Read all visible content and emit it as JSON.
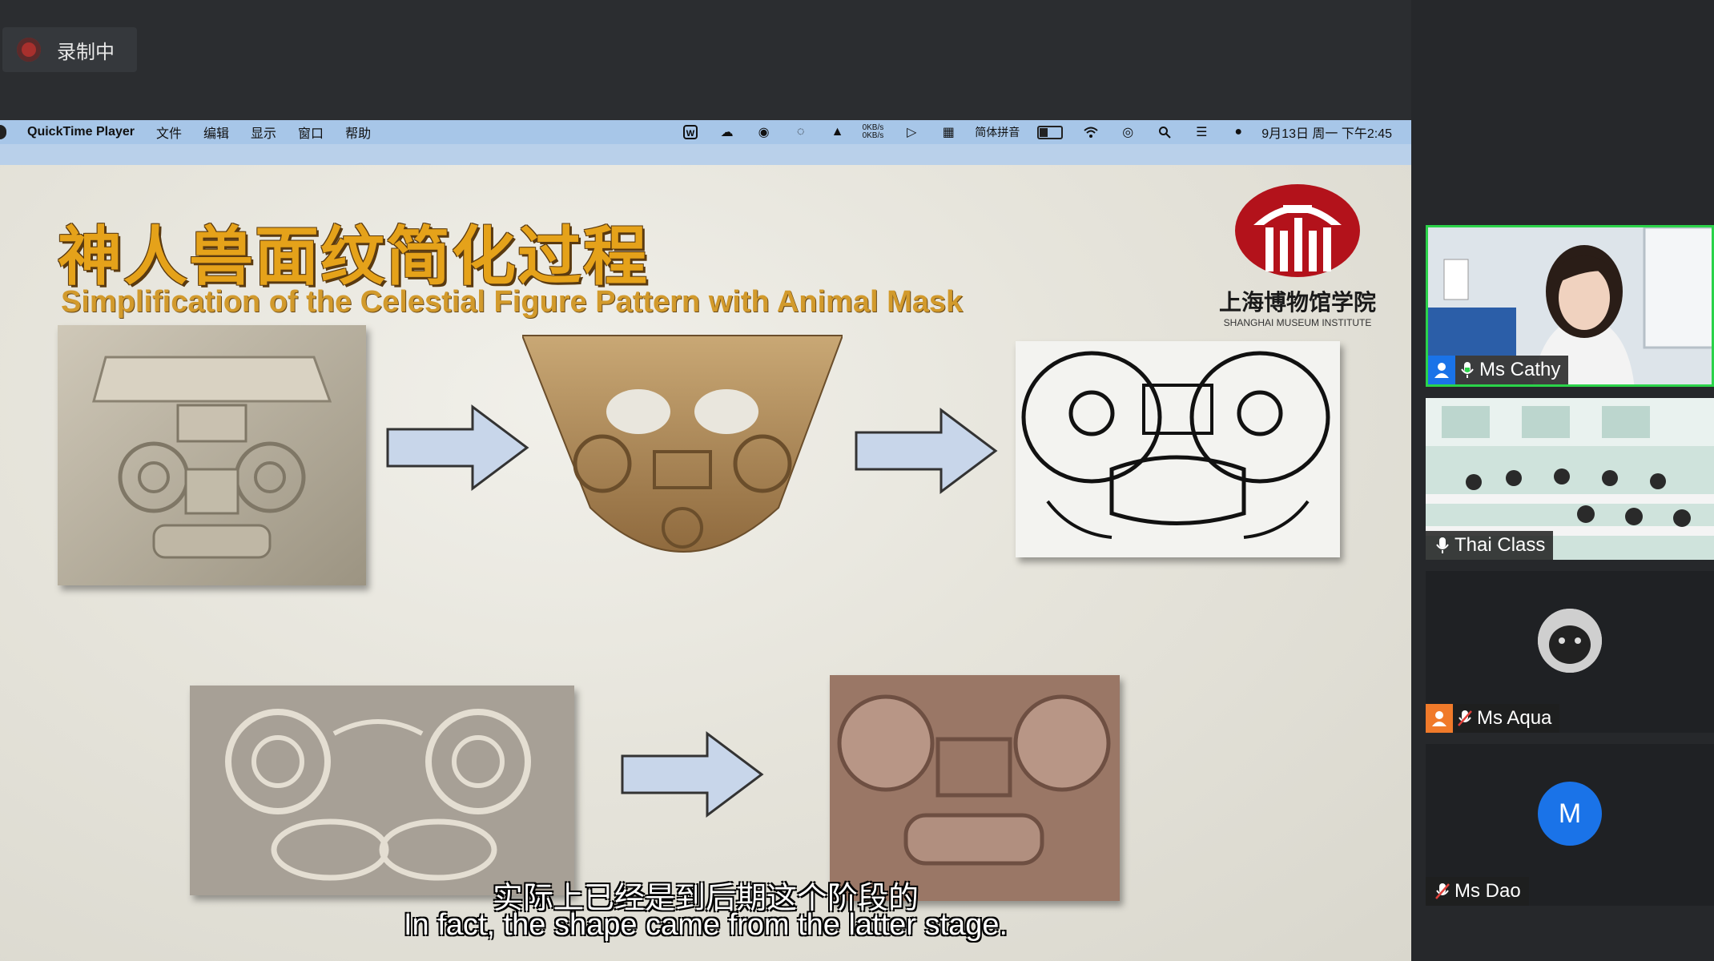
{
  "recording": {
    "label": "录制中"
  },
  "menubar": {
    "app_name": "QuickTime Player",
    "items": [
      "文件",
      "编辑",
      "显示",
      "窗口",
      "帮助"
    ],
    "net_speed_up": "0KB/s",
    "net_speed_down": "0KB/s",
    "input_method": "简体拼音",
    "clock": "9月13日 周一 下午2:45"
  },
  "slide": {
    "title_cn": "神人兽面纹简化过程",
    "title_en": "Simplification of the Celestial Figure Pattern with Animal Mask",
    "logo_cn": "上海博物馆学院",
    "logo_en": "SHANGHAI MUSEUM INSTITUTE",
    "subtitle_cn": "实际上已经是到后期这个阶段的",
    "subtitle_en": "In fact, the shape came from the latter stage."
  },
  "participants": [
    {
      "name": "Ms Cathy",
      "mic": "on",
      "active": true
    },
    {
      "name": "Thai Class",
      "mic": "on",
      "active": false
    },
    {
      "name": "Ms Aqua",
      "mic": "muted",
      "active": false
    },
    {
      "name": "Ms Dao",
      "mic": "muted",
      "active": false,
      "initial": "M"
    }
  ],
  "colors": {
    "active_speaker_border": "#2bd34a",
    "title_gold": "#e5a21a",
    "logo_red": "#b3121b",
    "avatar_blue": "#1a73e8"
  }
}
